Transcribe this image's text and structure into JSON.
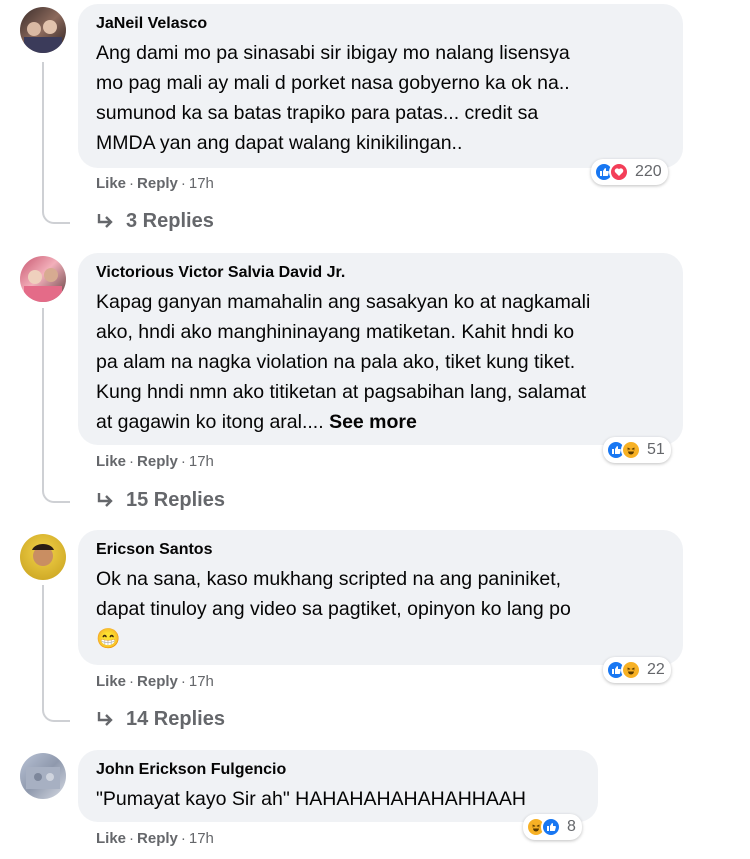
{
  "comments": [
    {
      "author": "JaNeil Velasco",
      "lines": [
        "Ang dami mo pa sinasabi sir ibigay mo nalang lisensya",
        "mo pag mali ay mali d porket nasa gobyerno ka ok na..",
        "sumunod ka sa batas trapiko para patas... credit sa",
        "MMDA yan ang dapat walang kinikilingan.."
      ],
      "like_label": "Like",
      "reply_label": "Reply",
      "time": "17h",
      "reaction_count": "220",
      "replies_label": "3 Replies"
    },
    {
      "author": "Victorious Victor Salvia David Jr.",
      "lines": [
        "Kapag ganyan mamahalin ang sasakyan ko at nagkamali",
        "ako, hndi ako manghininayang matiketan. Kahit hndi ko",
        "pa alam na nagka violation na pala ako, tiket kung tiket.",
        "Kung hndi nmn ako titiketan at pagsabihan lang, salamat",
        "at gagawin ko itong aral...."
      ],
      "see_more": "See more",
      "like_label": "Like",
      "reply_label": "Reply",
      "time": "17h",
      "reaction_count": "51",
      "replies_label": "15 Replies"
    },
    {
      "author": "Ericson Santos",
      "lines": [
        "Ok na sana, kaso mukhang scripted na ang paniniket,",
        "dapat tinuloy ang video sa pagtiket, opinyon ko lang po"
      ],
      "emoji": "😁",
      "like_label": "Like",
      "reply_label": "Reply",
      "time": "17h",
      "reaction_count": "22",
      "replies_label": "14 Replies"
    },
    {
      "author": "John Erickson Fulgencio",
      "lines": [
        "\"Pumayat kayo Sir ah\" HAHAHAHAHAHAHHAAH"
      ],
      "like_label": "Like",
      "reply_label": "Reply",
      "time": "17h",
      "reaction_count": "8"
    }
  ],
  "colors": {
    "bubble": "#f0f2f5",
    "secondary_text": "#65676b",
    "like_blue": "#1877f2",
    "love_red": "#f33e58",
    "haha_yellow": "#f7b125"
  }
}
